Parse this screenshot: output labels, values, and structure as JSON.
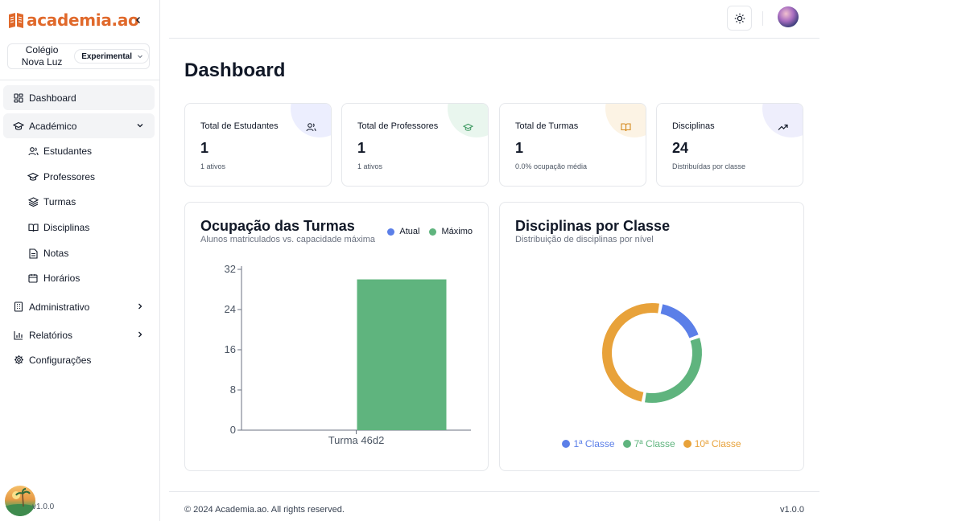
{
  "brand": {
    "name": "academia.ao"
  },
  "school": {
    "name": "Colégio Nova Luz",
    "plan": "Experimental"
  },
  "sidebar": {
    "items": [
      {
        "label": "Dashboard"
      },
      {
        "label": "Académico"
      },
      {
        "label": "Administrativo"
      },
      {
        "label": "Relatórios"
      },
      {
        "label": "Configurações"
      }
    ],
    "academic_sub": [
      {
        "label": "Estudantes"
      },
      {
        "label": "Professores"
      },
      {
        "label": "Turmas"
      },
      {
        "label": "Disciplinas"
      },
      {
        "label": "Notas"
      },
      {
        "label": "Horários"
      }
    ],
    "version": "v1.0.0"
  },
  "page": {
    "title": "Dashboard"
  },
  "stats": [
    {
      "title": "Total de Estudantes",
      "value": "1",
      "subtitle": "1 ativos",
      "icon": "users-icon",
      "blob_color": "#eceefe"
    },
    {
      "title": "Total de Professores",
      "value": "1",
      "subtitle": "1 ativos",
      "icon": "graduation-cap-icon",
      "blob_color": "#e9f6ee"
    },
    {
      "title": "Total de Turmas",
      "value": "1",
      "subtitle": "0.0% ocupação média",
      "icon": "book-open-icon",
      "blob_color": "#fcf3e4"
    },
    {
      "title": "Disciplinas",
      "value": "24",
      "subtitle": "Distribuídas por classe",
      "icon": "trending-up-icon",
      "blob_color": "#eeeefc"
    }
  ],
  "occupancy": {
    "title": "Ocupação das Turmas",
    "subtitle": "Alunos matriculados vs. capacidade máxima",
    "legend": [
      {
        "name": "Atual",
        "color": "#5b7fe8"
      },
      {
        "name": "Máximo",
        "color": "#5fb47e"
      }
    ]
  },
  "distribution": {
    "title": "Disciplinas por Classe",
    "subtitle": "Distribuição de disciplinas por nível"
  },
  "chart_data": [
    {
      "type": "bar",
      "categories": [
        "Turma 46d2"
      ],
      "series": [
        {
          "name": "Atual",
          "values": [
            0
          ],
          "color": "#5b7fe8"
        },
        {
          "name": "Máximo",
          "values": [
            30
          ],
          "color": "#5fb47e"
        }
      ],
      "yticks": [
        "0",
        "8",
        "16",
        "24",
        "32"
      ],
      "ylim": [
        0,
        32
      ],
      "title": "Ocupação das Turmas",
      "legend": "top-right",
      "grid": false
    },
    {
      "type": "pie",
      "labels": [
        "1ª Classe",
        "7ª Classe",
        "10ª Classe"
      ],
      "values": [
        4,
        8,
        12
      ],
      "colors": [
        "#5b7fe8",
        "#5fb47e",
        "#e8a23a"
      ],
      "title": "Disciplinas por Classe",
      "legend": "bottom"
    }
  ],
  "footer": {
    "copyright": "© 2024 Academia.ao. All rights reserved.",
    "version": "v1.0.0"
  }
}
